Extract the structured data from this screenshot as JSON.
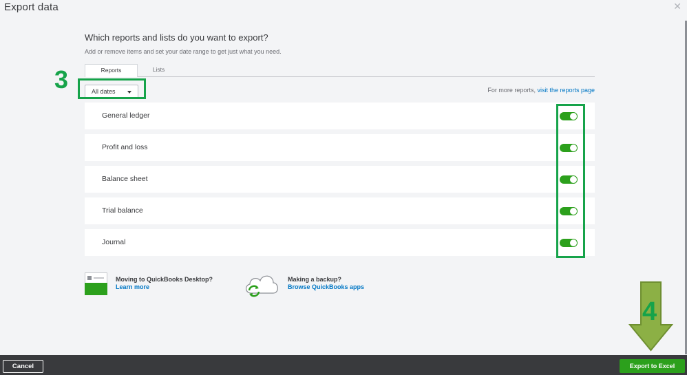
{
  "dialog": {
    "title": "Export data",
    "close_icon": "close-icon"
  },
  "header": {
    "heading": "Which reports and lists do you want to export?",
    "subheading": "Add or remove items and set your date range to get just what you need."
  },
  "tabs": [
    {
      "label": "Reports",
      "selected": true
    },
    {
      "label": "Lists",
      "selected": false
    }
  ],
  "date_filter": {
    "selected": "All dates",
    "icon": "caret-down-icon"
  },
  "more_reports": {
    "text": "For more reports, ",
    "link": "visit the reports page"
  },
  "reports": [
    {
      "label": "General ledger",
      "enabled": true
    },
    {
      "label": "Profit and loss",
      "enabled": true
    },
    {
      "label": "Balance sheet",
      "enabled": true
    },
    {
      "label": "Trial balance",
      "enabled": true
    },
    {
      "label": "Journal",
      "enabled": true
    }
  ],
  "promos": {
    "desktop": {
      "title": "Moving to QuickBooks Desktop?",
      "link": "Learn more",
      "icon": "desktop-app-icon"
    },
    "backup": {
      "title": "Making a backup?",
      "link": "Browse QuickBooks apps",
      "icon": "cloud-sync-icon"
    }
  },
  "annotations": {
    "step_3": "3",
    "step_4": "4",
    "highlight_color": "#16a34a"
  },
  "footer": {
    "cancel": "Cancel",
    "export": "Export to Excel"
  },
  "colors": {
    "accent": "#2ca01c",
    "link": "#0077c5",
    "footer_bg": "#393a3d"
  }
}
